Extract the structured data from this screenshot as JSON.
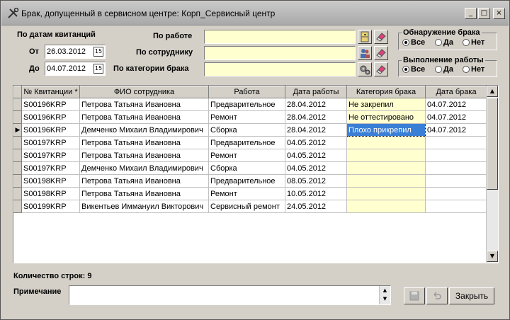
{
  "window": {
    "title": "Брак, допущенный в сервисном центре: Корп_Сервисный центр",
    "minimize_glyph": "_",
    "maximize_glyph": "□",
    "close_glyph": "×"
  },
  "filters": {
    "by_dates_label": "По датам квитанций",
    "from_label": "От",
    "from_value": "26.03.2012",
    "to_label": "До",
    "to_value": "04.07.2012",
    "calendar_glyph": "15",
    "by_work_label": "По работе",
    "by_employee_label": "По сотруднику",
    "by_defect_category_label": "По категории брака",
    "by_work_value": "",
    "by_employee_value": "",
    "by_defect_category_value": ""
  },
  "detection_group": {
    "title": "Обнаружение брака",
    "options": [
      "Все",
      "Да",
      "Нет"
    ],
    "selected": "Все"
  },
  "execution_group": {
    "title": "Выполнение работы",
    "options": [
      "Все",
      "Да",
      "Нет"
    ],
    "selected": "Все"
  },
  "grid": {
    "columns": [
      "№ Квитанции *",
      "ФИО сотрудника",
      "Работа",
      "Дата работы",
      "Категория брака",
      "Дата брака"
    ],
    "current_row_marker": "▶",
    "rows": [
      [
        "S00196KRP",
        "Петрова Татьяна Ивановна",
        "Предварительное",
        "28.04.2012",
        "Не закрепил",
        "04.07.2012"
      ],
      [
        "S00196KRP",
        "Петрова Татьяна Ивановна",
        "Ремонт",
        "28.04.2012",
        "Не оттестировано",
        "04.07.2012"
      ],
      [
        "S00196KRP",
        "Демченко Михаил Владимирович",
        "Сборка",
        "28.04.2012",
        "Плохо прикрепил",
        "04.07.2012"
      ],
      [
        "S00197KRP",
        "Петрова Татьяна Ивановна",
        "Предварительное",
        "04.05.2012",
        "",
        ""
      ],
      [
        "S00197KRP",
        "Петрова Татьяна Ивановна",
        "Ремонт",
        "04.05.2012",
        "",
        ""
      ],
      [
        "S00197KRP",
        "Демченко Михаил Владимирович",
        "Сборка",
        "04.05.2012",
        "",
        ""
      ],
      [
        "S00198KRP",
        "Петрова Татьяна Ивановна",
        "Предварительное",
        "08.05.2012",
        "",
        ""
      ],
      [
        "S00198KRP",
        "Петрова Татьяна Ивановна",
        "Ремонт",
        "10.05.2012",
        "",
        ""
      ],
      [
        "S00199KRP",
        "Викентьев Иммануил Викторович",
        "Сервисный ремонт",
        "24.05.2012",
        "",
        ""
      ]
    ],
    "current_row": 2,
    "selected_cell": [
      2,
      4
    ]
  },
  "footer": {
    "row_count_label": "Количество строк: 9",
    "note_label": "Примечание",
    "note_value": "",
    "close_button": "Закрыть"
  }
}
